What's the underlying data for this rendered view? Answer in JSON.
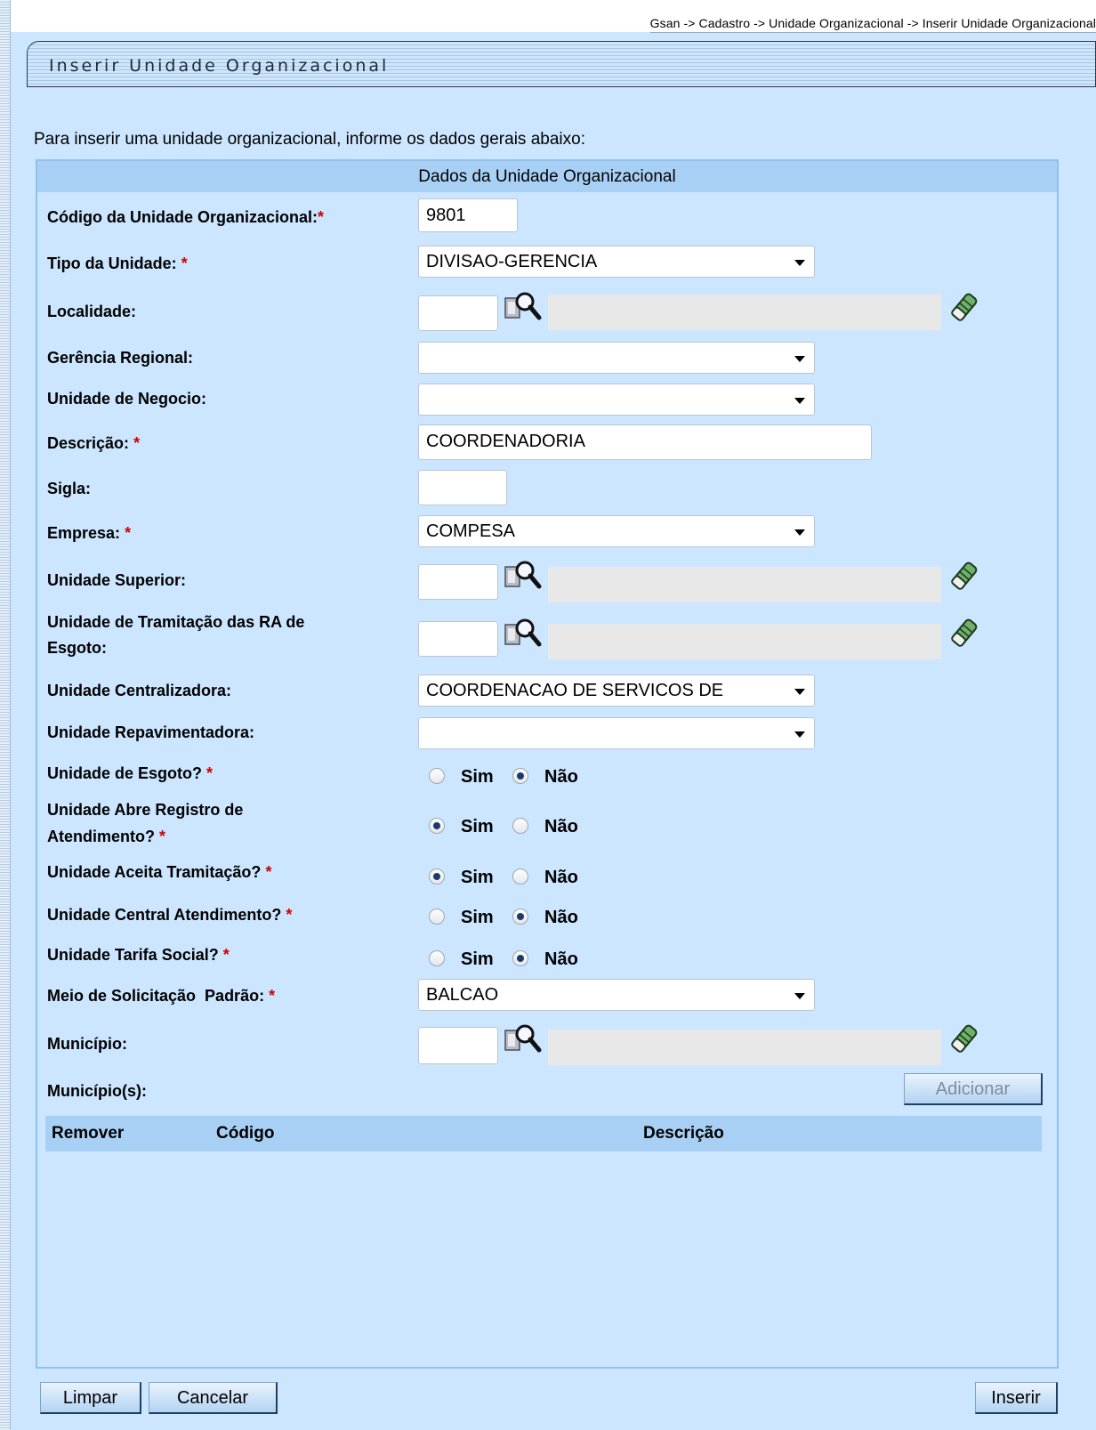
{
  "breadcrumb": "Gsan -> Cadastro -> Unidade Organizacional -> Inserir Unidade Organizacional",
  "page_title": "Inserir Unidade Organizacional",
  "intro": "Para inserir uma unidade organizacional, informe os dados gerais abaixo:",
  "panel_header": "Dados da Unidade Organizacional",
  "required_mark": "*",
  "fields": {
    "codigo": {
      "label": "Código da Unidade Organizacional:",
      "value": "9801"
    },
    "tipo": {
      "label": "Tipo da Unidade:",
      "value": "DIVISAO-GERENCIA"
    },
    "localidade": {
      "label": "Localidade:",
      "value": ""
    },
    "gerencia": {
      "label": "Gerência Regional:",
      "value": ""
    },
    "negocio": {
      "label": "Unidade de Negocio:",
      "value": ""
    },
    "descricao": {
      "label": "Descrição:",
      "value": "COORDENADORIA"
    },
    "sigla": {
      "label": "Sigla:",
      "value": ""
    },
    "empresa": {
      "label": "Empresa:",
      "value": "COMPESA"
    },
    "superior": {
      "label": "Unidade Superior:",
      "value": ""
    },
    "tramitacao": {
      "label_line1": "Unidade de Tramitação das RA de",
      "label_line2": "Esgoto:",
      "value": ""
    },
    "centralizadora": {
      "label": "Unidade Centralizadora:",
      "value": "COORDENACAO DE SERVICOS DE"
    },
    "repavimentadora": {
      "label": "Unidade Repavimentadora:",
      "value": ""
    },
    "meio": {
      "label": "Meio de Solicitação  Padrão:",
      "value": "BALCAO"
    },
    "municipio": {
      "label": "Município:",
      "value": ""
    }
  },
  "radio_options": {
    "yes": "Sim",
    "no": "Não"
  },
  "radios": {
    "esgoto": {
      "label": "Unidade de Esgoto?",
      "selected": "no"
    },
    "abre_registro": {
      "label_line1": "Unidade Abre Registro de",
      "label_line2": "Atendimento?",
      "selected": "yes"
    },
    "aceita_tramitacao": {
      "label": "Unidade Aceita Tramitação?",
      "selected": "yes"
    },
    "central_atendimento": {
      "label": "Unidade Central Atendimento?",
      "selected": "no"
    },
    "tarifa_social": {
      "label": "Unidade Tarifa Social?",
      "selected": "no"
    }
  },
  "municipios": {
    "label": "Município(s):",
    "add_button": "Adicionar",
    "columns": [
      "Remover",
      "Código",
      "Descrição"
    ],
    "rows": []
  },
  "buttons": {
    "limpar": "Limpar",
    "cancelar": "Cancelar",
    "inserir": "Inserir"
  },
  "icons": {
    "lookup": "magnifier-search-icon",
    "eraser": "eraser-clear-icon"
  }
}
